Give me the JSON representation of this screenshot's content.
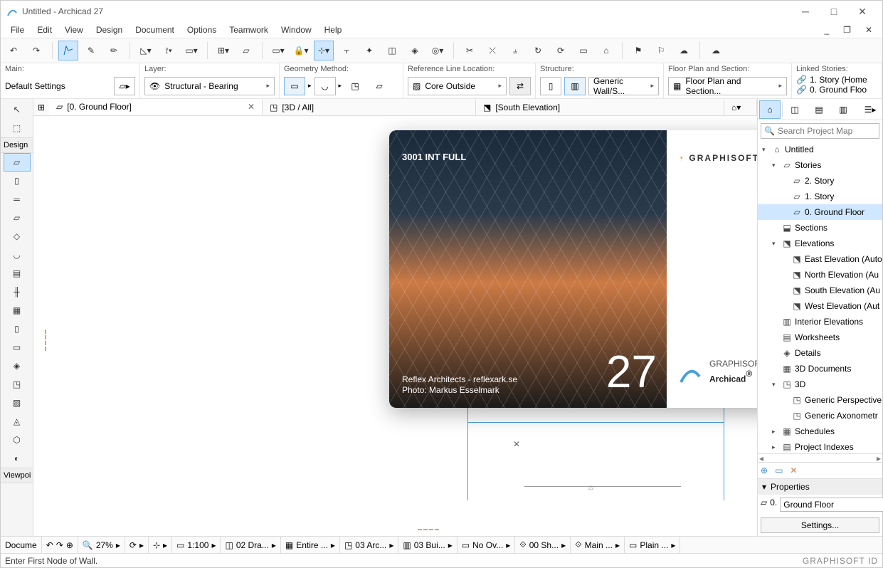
{
  "title": "Untitled - Archicad 27",
  "menu": [
    "File",
    "Edit",
    "View",
    "Design",
    "Document",
    "Options",
    "Teamwork",
    "Window",
    "Help"
  ],
  "options": {
    "main_label": "Main:",
    "main_value": "Default Settings",
    "layer_label": "Layer:",
    "layer_value": "Structural - Bearing",
    "geom_label": "Geometry Method:",
    "ref_label": "Reference Line Location:",
    "ref_value": "Core Outside",
    "struct_label": "Structure:",
    "struct_value": "Generic Wall/S...",
    "fps_label": "Floor Plan and Section:",
    "fps_value": "Floor Plan and Section...",
    "linked_label": "Linked Stories:",
    "linked_items": [
      "1. Story (Home",
      "0. Ground Floo"
    ]
  },
  "tabs": [
    {
      "label": "[0. Ground Floor]",
      "active": true,
      "close": true
    },
    {
      "label": "[3D / All]"
    },
    {
      "label": "[South Elevation]"
    }
  ],
  "palette": {
    "design_label": "Design",
    "viewpoi_label": "Viewpoi"
  },
  "splash": {
    "version_text": "3001 INT FULL",
    "version_num": "27",
    "credit1": "Reflex Architects - reflexark.se",
    "credit2": "Photo: Markus Esselmark",
    "brand_top": "GRAPHISOFT.",
    "brand_bot_small": "GRAPHISOFT",
    "brand_bot_big": "Archicad"
  },
  "nav": {
    "search_placeholder": "Search Project Map",
    "tree": [
      {
        "d": 0,
        "exp": "▾",
        "ic": "⌂",
        "t": "Untitled"
      },
      {
        "d": 1,
        "exp": "▾",
        "ic": "▱",
        "t": "Stories"
      },
      {
        "d": 2,
        "exp": "",
        "ic": "▱",
        "t": "2. Story"
      },
      {
        "d": 2,
        "exp": "",
        "ic": "▱",
        "t": "1. Story"
      },
      {
        "d": 2,
        "exp": "",
        "ic": "▱",
        "t": "0. Ground Floor",
        "sel": true
      },
      {
        "d": 1,
        "exp": "",
        "ic": "⬓",
        "t": "Sections"
      },
      {
        "d": 1,
        "exp": "▾",
        "ic": "⬔",
        "t": "Elevations"
      },
      {
        "d": 2,
        "exp": "",
        "ic": "⬔",
        "t": "East Elevation (Auto"
      },
      {
        "d": 2,
        "exp": "",
        "ic": "⬔",
        "t": "North Elevation (Au"
      },
      {
        "d": 2,
        "exp": "",
        "ic": "⬔",
        "t": "South Elevation (Au"
      },
      {
        "d": 2,
        "exp": "",
        "ic": "⬔",
        "t": "West Elevation (Aut"
      },
      {
        "d": 1,
        "exp": "",
        "ic": "▥",
        "t": "Interior Elevations"
      },
      {
        "d": 1,
        "exp": "",
        "ic": "▤",
        "t": "Worksheets"
      },
      {
        "d": 1,
        "exp": "",
        "ic": "◈",
        "t": "Details"
      },
      {
        "d": 1,
        "exp": "",
        "ic": "▦",
        "t": "3D Documents"
      },
      {
        "d": 1,
        "exp": "▾",
        "ic": "◳",
        "t": "3D"
      },
      {
        "d": 2,
        "exp": "",
        "ic": "◳",
        "t": "Generic Perspective"
      },
      {
        "d": 2,
        "exp": "",
        "ic": "◳",
        "t": "Generic Axonometr"
      },
      {
        "d": 1,
        "exp": "▸",
        "ic": "▦",
        "t": "Schedules"
      },
      {
        "d": 1,
        "exp": "▸",
        "ic": "▤",
        "t": "Project Indexes"
      }
    ],
    "props_label": "Properties",
    "props_id": "0.",
    "props_name": "Ground Floor",
    "settings_btn": "Settings..."
  },
  "bottombar": {
    "docume": "Docume",
    "zoom": "27%",
    "scale": "1:100",
    "items": [
      "02 Dra...",
      "Entire ...",
      "03 Arc...",
      "03 Bui...",
      "No Ov...",
      "00 Sh...",
      "Main ...",
      "Plain ..."
    ]
  },
  "status_prompt": "Enter First Node of Wall.",
  "status_brand": "GRAPHISOFT ID"
}
